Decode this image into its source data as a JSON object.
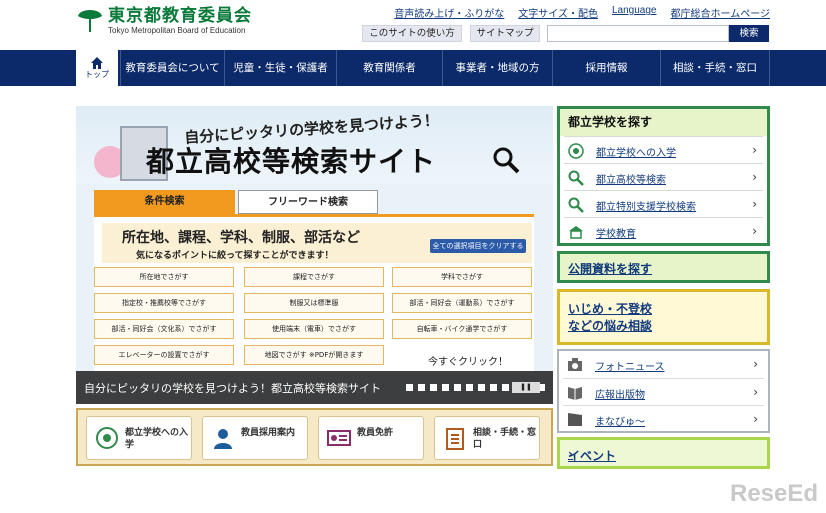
{
  "header": {
    "site_title": "東京都教育委員会",
    "site_subtitle": "Tokyo Metropolitan Board of Education",
    "util_links": [
      "音声読み上げ・ふりがな",
      "文字サイズ・配色",
      "Language",
      "都庁総合ホームページ"
    ],
    "usage_button": "このサイトの使い方",
    "sitemap_button": "サイトマップ",
    "search_placeholder": "",
    "search_button": "検索"
  },
  "nav": {
    "home_label": "トップ",
    "items": [
      "教育委員会について",
      "児童・生徒・保護者",
      "教育関係者",
      "事業者・地域の方",
      "採用情報",
      "相談・手続・窓口"
    ]
  },
  "banner": {
    "tagline": "自分にピッタリの学校を見つけよう！",
    "title": "都立高校等検索サイト",
    "tab_condition": "条件検索",
    "tab_freeword": "フリーワード検索",
    "panel_heading": "所在地、課程、学科、制服、部活など",
    "panel_subheading": "気になるポイントに絞って探すことができます！",
    "clear_button": "全ての選択項目をクリアする",
    "options": [
      "所在地でさがす",
      "課程でさがす",
      "学科でさがす",
      "指定校・推薦校等でさがす",
      "制服又は標準服",
      "部活・同好会（運動系）でさがす",
      "部活・同好会（文化系）でさがす",
      "使用端末（電車）でさがす",
      "自転車・バイク通学でさがす",
      "エレベーターの設置でさがす",
      "地図でさがす ※PDFが開きます"
    ],
    "click_note": "今すぐクリック！",
    "caption": "自分にピッタリの学校を見つけよう！都立高校等検索サイト",
    "pause_label": "❚❚"
  },
  "quick_links": [
    {
      "label": "都立学校への入学",
      "icon": "flower-emblem-icon"
    },
    {
      "label": "教員採用案内",
      "icon": "person-icon"
    },
    {
      "label": "教員免許",
      "icon": "license-card-icon"
    },
    {
      "label": "相談・手続・窓口",
      "icon": "clipboard-icon"
    }
  ],
  "sidebar": {
    "school_heading": "都立学校を探す",
    "school_links": [
      {
        "label": "都立学校への入学",
        "icon": "flower-emblem-icon"
      },
      {
        "label": "都立高校等検索",
        "icon": "search-icon"
      },
      {
        "label": "都立特別支援学校検索",
        "icon": "search-icon"
      },
      {
        "label": "学校教育",
        "icon": "school-icon"
      }
    ],
    "public_docs": "公開資料を探す",
    "bullying_line1": "いじめ・不登校",
    "bullying_line2": "などの悩み相談",
    "media_links": [
      {
        "label": "フォトニュース",
        "icon": "camera-icon"
      },
      {
        "label": "広報出版物",
        "icon": "book-icon"
      },
      {
        "label": "まなびゅ〜",
        "icon": "film-icon"
      }
    ],
    "event": "イベント"
  },
  "watermark": "ReseEd",
  "colors": {
    "navy": "#0c2a6a",
    "green": "#2f8a4b",
    "orange": "#f19a1e",
    "yellow": "#d9b82a"
  }
}
